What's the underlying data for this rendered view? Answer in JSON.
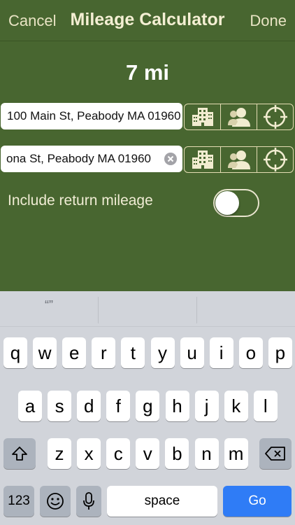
{
  "navbar": {
    "cancel": "Cancel",
    "title": "Mileage Calculator",
    "done": "Done"
  },
  "distance": "7 mi",
  "fields": {
    "origin_value": "100 Main St, Peabody MA 01960",
    "destination_value": "ona St, Peabody MA 01960"
  },
  "icons": {
    "row": [
      "buildings-icon",
      "contact-person-icon",
      "location-target-icon"
    ]
  },
  "options": {
    "return_label": "Include return mileage",
    "return_enabled": false
  },
  "colors": {
    "background": "#486630",
    "accent": "#e4dcb3",
    "go_key": "#2f7cf6"
  },
  "keyboard": {
    "suggestion": "“”",
    "row1": [
      "q",
      "w",
      "e",
      "r",
      "t",
      "y",
      "u",
      "i",
      "o",
      "p"
    ],
    "row2": [
      "a",
      "s",
      "d",
      "f",
      "g",
      "h",
      "j",
      "k",
      "l"
    ],
    "row3": [
      "z",
      "x",
      "c",
      "v",
      "b",
      "n",
      "m"
    ],
    "numbers_label": "123",
    "space_label": "space",
    "go_label": "Go"
  }
}
